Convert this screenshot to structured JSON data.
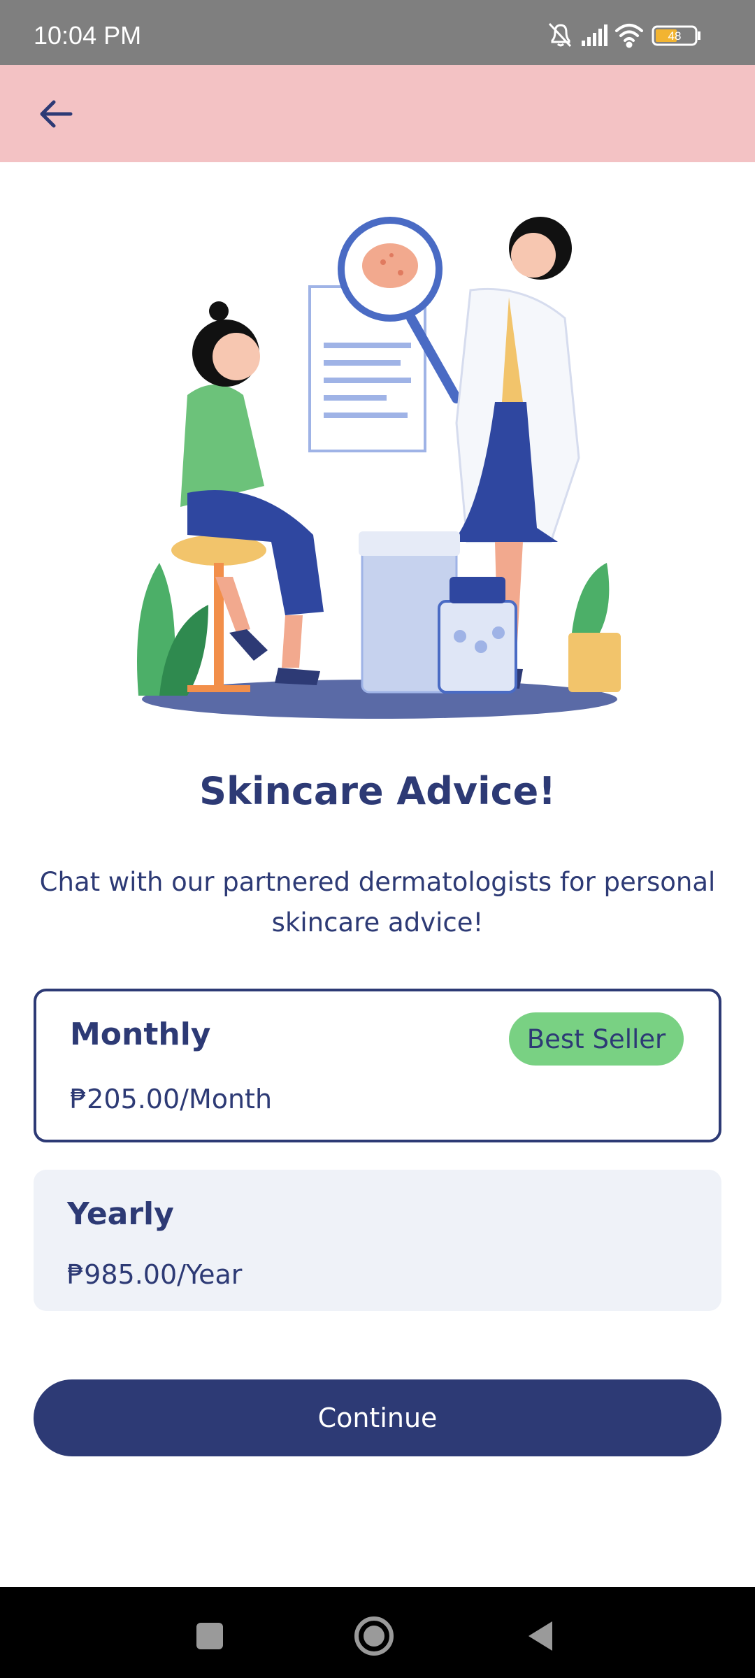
{
  "status_bar": {
    "time": "10:04 PM",
    "battery": "48",
    "icons": [
      "bell-off-icon",
      "signal-icon",
      "wifi-icon",
      "battery-icon"
    ]
  },
  "header": {
    "back_icon": "arrow-left-icon",
    "background_color": "#f3c2c4"
  },
  "main": {
    "title": "Skincare Advice!",
    "subtitle_line1": "Chat with our partnered dermatologists for personal",
    "subtitle_line2": "skincare advice!"
  },
  "plans": [
    {
      "name": "Monthly",
      "price": "₱205.00/Month",
      "badge": "Best Seller",
      "selected": true
    },
    {
      "name": "Yearly",
      "price": "₱985.00/Year",
      "selected": false
    }
  ],
  "continue_label": "Continue",
  "nav": {
    "items": [
      "recents-icon",
      "home-icon",
      "back-icon"
    ]
  },
  "colors": {
    "accent": "#2d3a75",
    "badge": "#79d183",
    "header": "#f3c2c4",
    "status_bar": "#7f7f7f"
  }
}
